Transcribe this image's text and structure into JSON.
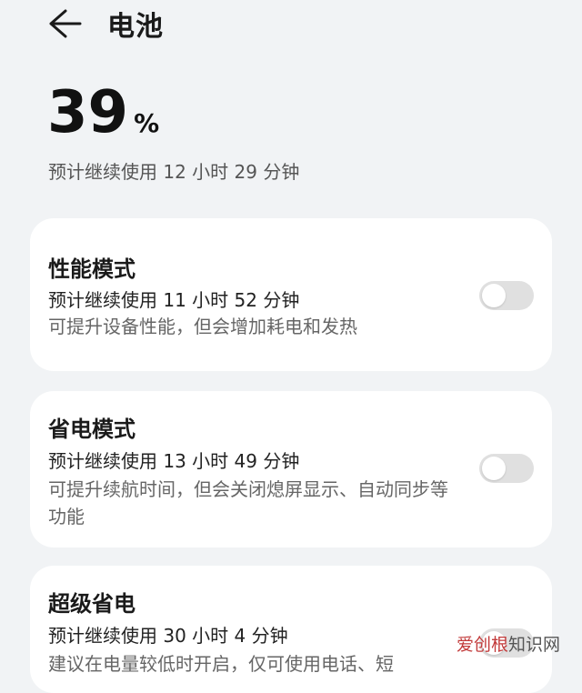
{
  "header": {
    "title": "电池"
  },
  "battery": {
    "level": "39",
    "unit": "%",
    "estimate": "预计继续使用 12 小时 29 分钟"
  },
  "modes": [
    {
      "title": "性能模式",
      "estimate": "预计继续使用 11 小时 52 分钟",
      "description": "可提升设备性能，但会增加耗电和发热",
      "enabled": false
    },
    {
      "title": "省电模式",
      "estimate": "预计继续使用 13 小时 49 分钟",
      "description": "可提升续航时间，但会关闭熄屏显示、自动同步等功能",
      "enabled": false
    },
    {
      "title": "超级省电",
      "estimate": "预计继续使用 30 小时 4 分钟",
      "description": "建议在电量较低时开启，仅可使用电话、短",
      "enabled": false
    }
  ],
  "watermark": {
    "brand": "爱创根",
    "rest": "知识网"
  },
  "colors": {
    "background": "#f1f3f5",
    "card": "#ffffff",
    "toggle_off": "#e0e0e0",
    "watermark": "#c23a3a"
  },
  "icons": {
    "back": "arrow-left-icon"
  }
}
